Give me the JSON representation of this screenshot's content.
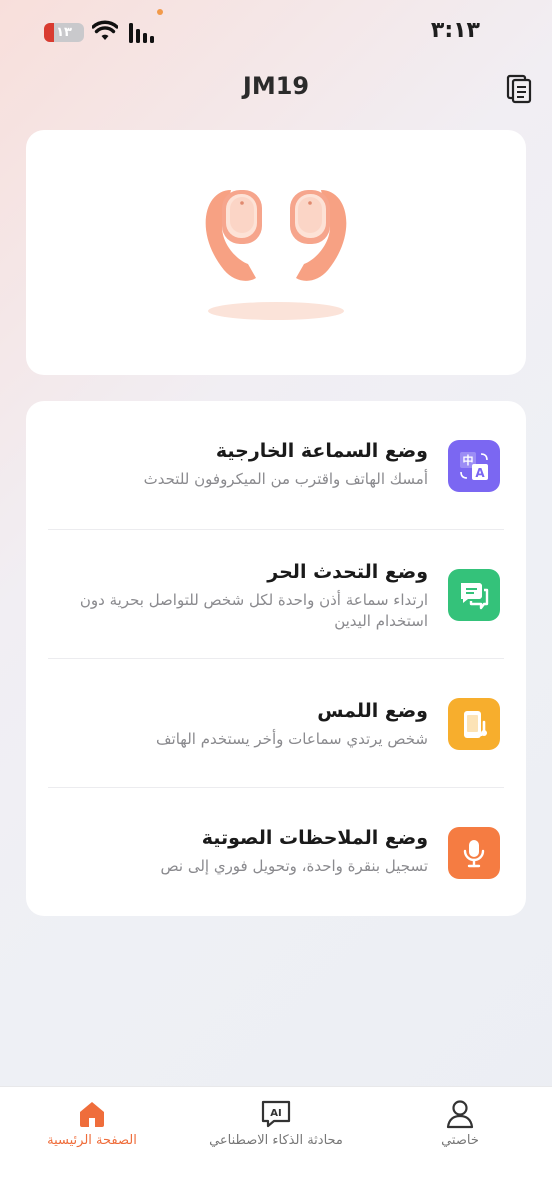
{
  "status_bar": {
    "time": "٣:١٣",
    "battery_level": "١٣",
    "battery_color": "#d93b30"
  },
  "header": {
    "title": "JM19",
    "doc_icon": "document-list-icon"
  },
  "hero": {
    "image": "earbuds-illustration",
    "accent": "#f7a183"
  },
  "modes": [
    {
      "title": "وضع السماعة الخارجية",
      "desc": "أمسك الهاتف واقترب من الميكروفون للتحدث",
      "icon": "translate-icon",
      "color": "#7b67f2"
    },
    {
      "title": "وضع التحدث الحر",
      "desc": "ارتداء سماعة أذن واحدة لكل شخص للتواصل بحرية دون استخدام اليدين",
      "icon": "chat-bubbles-icon",
      "color": "#34c27a"
    },
    {
      "title": "وضع اللمس",
      "desc": "شخص يرتدي سماعات وأخر يستخدم الهاتف",
      "icon": "phone-touch-icon",
      "color": "#f7ae2d"
    },
    {
      "title": "وضع الملاحظات الصوتية",
      "desc": "تسجيل بنقرة واحدة، وتحويل فوري إلى نص",
      "icon": "microphone-icon",
      "color": "#f57c42"
    }
  ],
  "tabbar": {
    "home_label": "الصفحة الرئيسية",
    "ai_label": "محادثة الذكاء الاصطناعي",
    "ai_icon_text": "AI",
    "profile_label": "خاصتي",
    "active_color": "#ef6d3b"
  }
}
